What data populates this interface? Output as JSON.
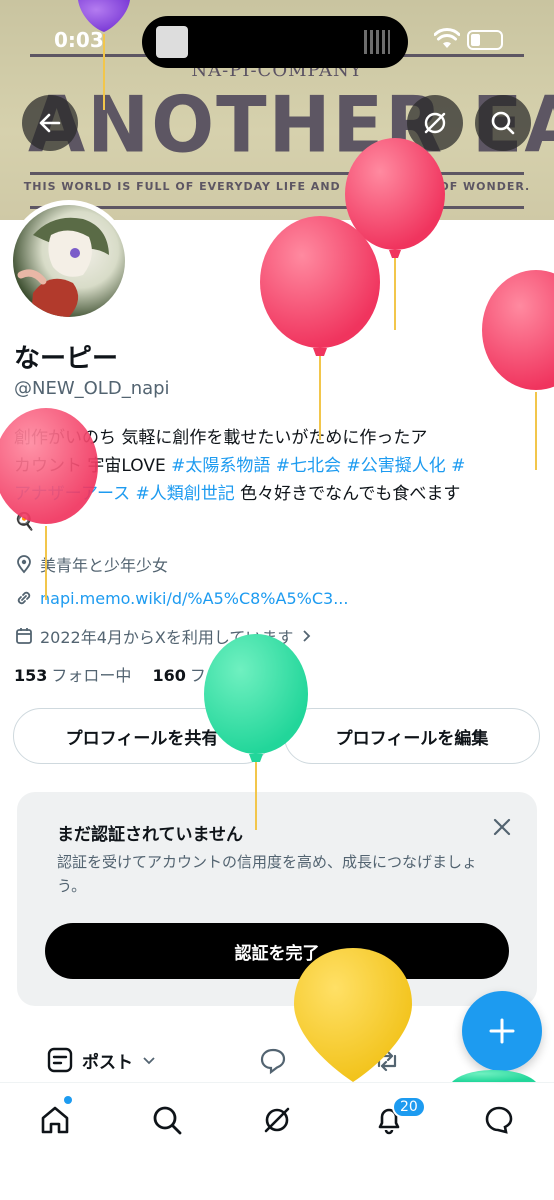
{
  "status_bar": {
    "time": "0:03"
  },
  "banner": {
    "company": "NA-PI-COMPANY",
    "title": "ANOTHER EARTH",
    "tagline": "THIS WORLD IS FULL OF EVERYDAY LIFE AND A LITTLE BIT OF WONDER."
  },
  "header_buttons": {
    "back": "back-arrow-icon",
    "grok": "grok-icon",
    "search": "search-icon"
  },
  "profile": {
    "name": "なーピー",
    "handle": "@NEW_OLD_napi",
    "bio_lines": [
      {
        "text": "創作がいのち 気軽に創作を載せたいがために作ったア",
        "tags": []
      },
      {
        "text": "カウント 宇宙LOVE ",
        "tags": [
          "#太陽系物語",
          "#七北会",
          "#公害擬人化",
          "#"
        ]
      },
      {
        "text": "",
        "tags": [
          "アナザーアース",
          "#人類創世記"
        ],
        "suffix": " 色々好きでなんでも食べます"
      }
    ],
    "bio_end_emoji": "🍳",
    "location": "美青年と少年少女",
    "website": "napi.memo.wiki/d/%A5%C8%A5%C3...",
    "joined": "2022年4月からXを利用しています",
    "following_count": "153",
    "following_label": "フォロー中",
    "followers_count": "160",
    "followers_label": "フォロワー"
  },
  "actions": {
    "share": "プロフィールを共有",
    "edit": "プロフィールを編集"
  },
  "verify_card": {
    "title": "まだ認証されていません",
    "description": "認証を受けてアカウントの信用度を高め、成長につなげましょう。",
    "button": "認証を完了"
  },
  "tabs": {
    "post_label": "ポスト"
  },
  "bottom_nav": {
    "notification_badge": "20"
  },
  "colors": {
    "accent": "#1d9bf0",
    "text": "#0f1419",
    "muted": "#536471"
  }
}
